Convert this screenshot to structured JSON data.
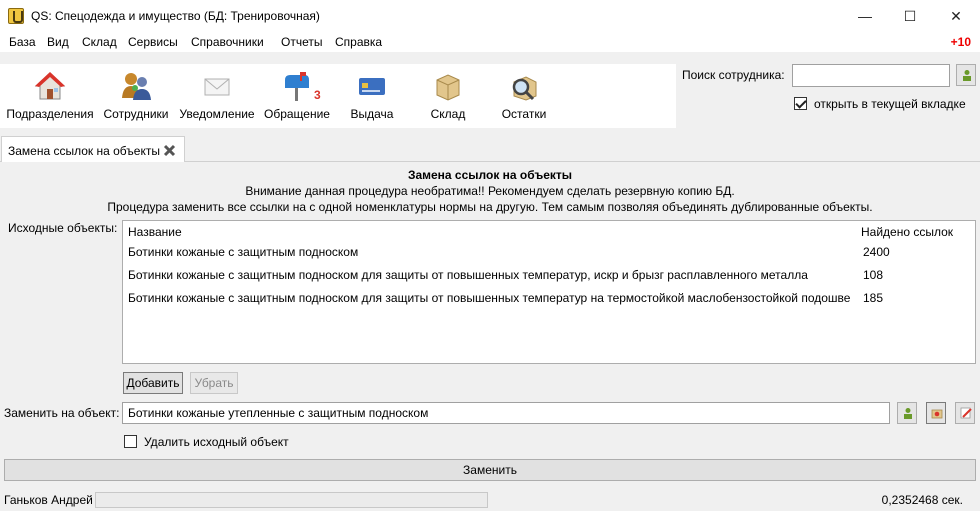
{
  "window": {
    "title": "QS: Спецодежда и имущество (БД: Тренировочная)",
    "minimize": "—",
    "maximize": "☐",
    "close": "✕"
  },
  "menu": {
    "items": [
      "База",
      "Вид",
      "Склад",
      "Сервисы",
      "Справочники",
      "Отчеты",
      "Справка"
    ],
    "badge": "+10"
  },
  "toolbar": {
    "buttons": [
      {
        "label": "Подразделения",
        "icon": "house-icon"
      },
      {
        "label": "Сотрудники",
        "icon": "people-icon"
      },
      {
        "label": "Уведомление",
        "icon": "envelope-icon"
      },
      {
        "label": "Обращение",
        "icon": "mailbox-icon",
        "count": "3"
      },
      {
        "label": "Выдача",
        "icon": "card-icon"
      },
      {
        "label": "Склад",
        "icon": "box-icon"
      },
      {
        "label": "Остатки",
        "icon": "magnifier-icon"
      }
    ]
  },
  "search": {
    "label": "Поиск сотрудника:",
    "value": "",
    "open_in_tab_label": "открыть в текущей вкладке",
    "open_in_tab_checked": true
  },
  "tab": {
    "label": "Замена ссылок на объекты"
  },
  "main": {
    "heading": "Замена ссылок на объекты",
    "warning": "Внимание данная процедура необратима!! Рекомендуем сделать резервную копию БД.",
    "description": "Процедура заменить все ссылки на с одной номенклатуры нормы на другую. Тем самым позволяя объединять дублированные объекты.",
    "source_label": "Исходные объекты:",
    "columns": [
      "Название",
      "Найдено ссылок"
    ],
    "rows": [
      {
        "name": "Ботинки кожаные с защитным подноском",
        "count": "2400"
      },
      {
        "name": "Ботинки кожаные с защитным подноском для защиты от повышенных температур, искр и брызг расплавленного металла",
        "count": "108"
      },
      {
        "name": "Ботинки кожаные с защитным подноском для защиты от повышенных температур на термостойкой маслобензостойкой подошве",
        "count": "185"
      }
    ],
    "add_label": "Добавить",
    "remove_label": "Убрать",
    "replace_with_label": "Заменить на объект:",
    "replace_with_value": "Ботинки кожаные утепленные с защитным подноском",
    "delete_source_label": "Удалить исходный объект",
    "delete_source_checked": false,
    "replace_button_label": "Заменить"
  },
  "status": {
    "user": "Ганьков Андрей",
    "time": "0,2352468 сек."
  }
}
